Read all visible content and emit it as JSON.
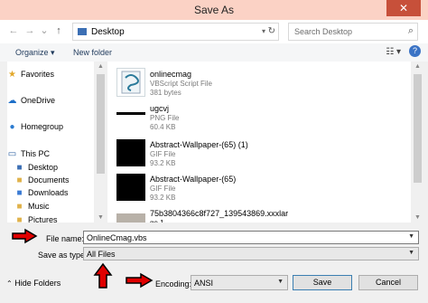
{
  "window": {
    "title": "Save As",
    "close_label": "✕"
  },
  "navbar": {
    "back": "←",
    "forward": "→",
    "up_dropdown": "⌄",
    "up": "↑",
    "address": "Desktop",
    "search_placeholder": "Search Desktop"
  },
  "toolbar": {
    "organize": "Organize ▾",
    "new_folder": "New folder"
  },
  "nav": {
    "items": [
      {
        "label": "Favorites",
        "icon": "star-icon"
      },
      {
        "label": "OneDrive",
        "icon": "cloud-icon"
      },
      {
        "label": "Homegroup",
        "icon": "homegroup-icon"
      },
      {
        "label": "This PC",
        "icon": "computer-icon"
      },
      {
        "label": "Desktop",
        "icon": "folder-icon"
      },
      {
        "label": "Documents",
        "icon": "folder-icon"
      },
      {
        "label": "Downloads",
        "icon": "folder-icon"
      },
      {
        "label": "Music",
        "icon": "folder-icon"
      },
      {
        "label": "Pictures",
        "icon": "folder-icon"
      }
    ]
  },
  "files": [
    {
      "name": "onlinecmag",
      "type": "VBScript Script File",
      "size": "381 bytes"
    },
    {
      "name": "ugcvj",
      "type": "PNG File",
      "size": "60.4 KB"
    },
    {
      "name": "Abstract-Wallpaper-(65) (1)",
      "type": "GIF File",
      "size": "93.2 KB"
    },
    {
      "name": "Abstract-Wallpaper-(65)",
      "type": "GIF File",
      "size": "93.2 KB"
    },
    {
      "name": "75b3804366c8f727_139543869.xxxlar",
      "type": "ge.1",
      "size": ""
    }
  ],
  "form": {
    "filename_label": "File name:",
    "filename_value": "OnlineCmag.vbs",
    "savetype_label": "Save as type:",
    "savetype_value": "All Files",
    "encoding_label": "Encoding:",
    "encoding_value": "ANSI",
    "hide_folders": "Hide Folders",
    "save": "Save",
    "cancel": "Cancel"
  },
  "colors": {
    "titlebar": "#fbd2c5",
    "close": "#c7503a",
    "annotation_arrow": "#e00000"
  }
}
